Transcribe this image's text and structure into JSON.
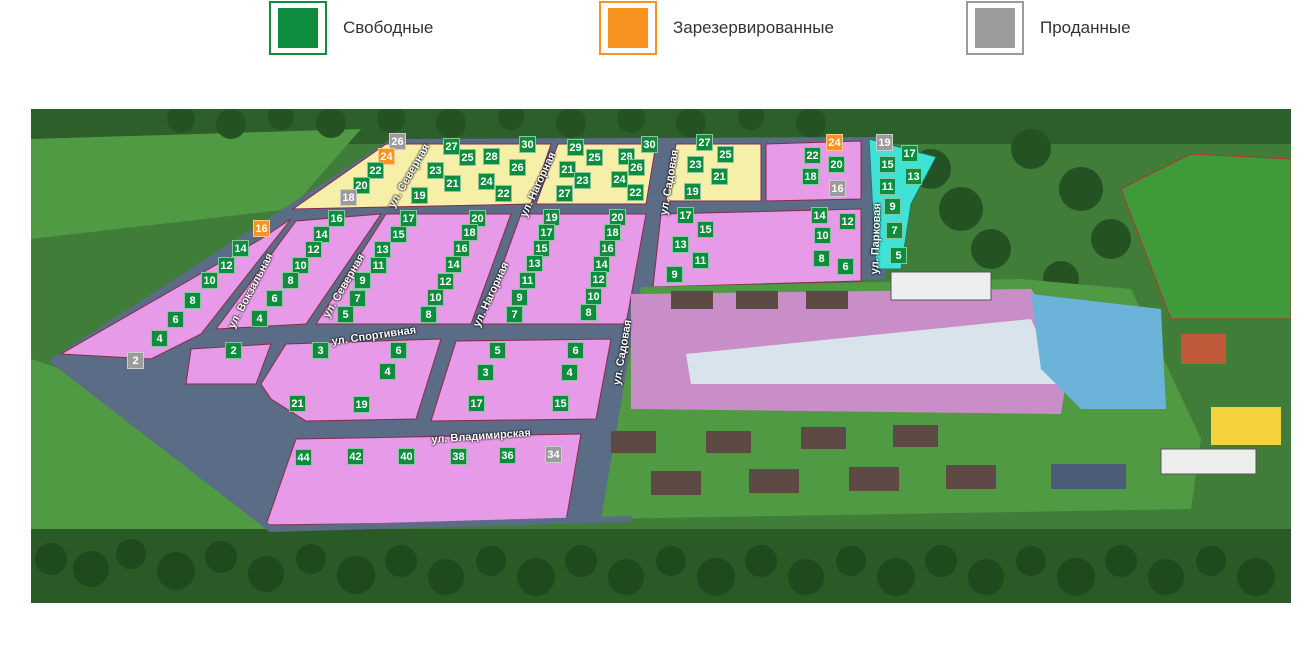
{
  "legend": [
    {
      "label": "Свободные",
      "color": "#0e8d3e",
      "border": "#0e8d3e"
    },
    {
      "label": "Зарезервированные",
      "color": "#f7931e",
      "border": "#f7931e"
    },
    {
      "label": "Проданные",
      "color": "#9b9b9b",
      "border": "#9b9b9b"
    }
  ],
  "colors": {
    "free": "#0e8d3e",
    "reserved": "#f7931e",
    "sold": "#9b9b9b",
    "plot_pink": "#e79ae8",
    "plot_yellow": "#f6efa8",
    "plot_cyan": "#3ee3d6",
    "road": "#5b6c86",
    "forest": "#2f6e2f"
  },
  "streets": [
    {
      "name": "ул. Вокзальная"
    },
    {
      "name": "ул. Северная"
    },
    {
      "name": "ул. Северная"
    },
    {
      "name": "ул. Нагорная"
    },
    {
      "name": "ул. Нагорная"
    },
    {
      "name": "ул. Садовая"
    },
    {
      "name": "ул. Садовая"
    },
    {
      "name": "ул. Парковая"
    },
    {
      "name": "ул. Спортивная"
    },
    {
      "name": "ул. Владимирская"
    }
  ],
  "plots": [
    {
      "n": "26",
      "status": "sold"
    },
    {
      "n": "24",
      "status": "reserved"
    },
    {
      "n": "22",
      "status": "free"
    },
    {
      "n": "20",
      "status": "free"
    },
    {
      "n": "18",
      "status": "sold"
    },
    {
      "n": "27",
      "status": "free"
    },
    {
      "n": "25",
      "status": "free"
    },
    {
      "n": "23",
      "status": "free"
    },
    {
      "n": "21",
      "status": "free"
    },
    {
      "n": "19",
      "status": "free"
    },
    {
      "n": "28",
      "status": "free"
    },
    {
      "n": "26",
      "status": "free"
    },
    {
      "n": "24",
      "status": "free"
    },
    {
      "n": "22",
      "status": "free"
    },
    {
      "n": "30",
      "status": "free"
    },
    {
      "n": "29",
      "status": "free"
    },
    {
      "n": "25",
      "status": "free"
    },
    {
      "n": "21",
      "status": "free"
    },
    {
      "n": "27",
      "status": "free"
    },
    {
      "n": "23",
      "status": "free"
    },
    {
      "n": "28",
      "status": "free"
    },
    {
      "n": "24",
      "status": "free"
    },
    {
      "n": "30",
      "status": "free"
    },
    {
      "n": "26",
      "status": "free"
    },
    {
      "n": "22",
      "status": "free"
    },
    {
      "n": "27",
      "status": "free"
    },
    {
      "n": "25",
      "status": "free"
    },
    {
      "n": "23",
      "status": "free"
    },
    {
      "n": "21",
      "status": "free"
    },
    {
      "n": "19",
      "status": "free"
    },
    {
      "n": "24",
      "status": "reserved"
    },
    {
      "n": "22",
      "status": "free"
    },
    {
      "n": "20",
      "status": "free"
    },
    {
      "n": "18",
      "status": "free"
    },
    {
      "n": "16",
      "status": "sold"
    },
    {
      "n": "19",
      "status": "sold"
    },
    {
      "n": "17",
      "status": "free"
    },
    {
      "n": "15",
      "status": "free"
    },
    {
      "n": "13",
      "status": "free"
    },
    {
      "n": "11",
      "status": "free"
    },
    {
      "n": "9",
      "status": "free"
    },
    {
      "n": "7",
      "status": "free"
    },
    {
      "n": "5",
      "status": "free"
    },
    {
      "n": "16",
      "status": "reserved"
    },
    {
      "n": "14",
      "status": "free"
    },
    {
      "n": "12",
      "status": "free"
    },
    {
      "n": "10",
      "status": "free"
    },
    {
      "n": "8",
      "status": "free"
    },
    {
      "n": "6",
      "status": "free"
    },
    {
      "n": "4",
      "status": "free"
    },
    {
      "n": "2",
      "status": "sold"
    },
    {
      "n": "16",
      "status": "free"
    },
    {
      "n": "14",
      "status": "free"
    },
    {
      "n": "12",
      "status": "free"
    },
    {
      "n": "10",
      "status": "free"
    },
    {
      "n": "8",
      "status": "free"
    },
    {
      "n": "6",
      "status": "free"
    },
    {
      "n": "4",
      "status": "free"
    },
    {
      "n": "17",
      "status": "free"
    },
    {
      "n": "15",
      "status": "free"
    },
    {
      "n": "13",
      "status": "free"
    },
    {
      "n": "11",
      "status": "free"
    },
    {
      "n": "9",
      "status": "free"
    },
    {
      "n": "7",
      "status": "free"
    },
    {
      "n": "5",
      "status": "free"
    },
    {
      "n": "20",
      "status": "free"
    },
    {
      "n": "18",
      "status": "free"
    },
    {
      "n": "16",
      "status": "free"
    },
    {
      "n": "14",
      "status": "free"
    },
    {
      "n": "12",
      "status": "free"
    },
    {
      "n": "10",
      "status": "free"
    },
    {
      "n": "8",
      "status": "free"
    },
    {
      "n": "19",
      "status": "free"
    },
    {
      "n": "17",
      "status": "free"
    },
    {
      "n": "15",
      "status": "free"
    },
    {
      "n": "13",
      "status": "free"
    },
    {
      "n": "11",
      "status": "free"
    },
    {
      "n": "9",
      "status": "free"
    },
    {
      "n": "7",
      "status": "free"
    },
    {
      "n": "20",
      "status": "free"
    },
    {
      "n": "18",
      "status": "free"
    },
    {
      "n": "16",
      "status": "free"
    },
    {
      "n": "14",
      "status": "free"
    },
    {
      "n": "12",
      "status": "free"
    },
    {
      "n": "10",
      "status": "free"
    },
    {
      "n": "8",
      "status": "free"
    },
    {
      "n": "17",
      "status": "free"
    },
    {
      "n": "15",
      "status": "free"
    },
    {
      "n": "13",
      "status": "free"
    },
    {
      "n": "11",
      "status": "free"
    },
    {
      "n": "9",
      "status": "free"
    },
    {
      "n": "14",
      "status": "free"
    },
    {
      "n": "12",
      "status": "free"
    },
    {
      "n": "10",
      "status": "free"
    },
    {
      "n": "8",
      "status": "free"
    },
    {
      "n": "6",
      "status": "free"
    },
    {
      "n": "2",
      "status": "free"
    },
    {
      "n": "3",
      "status": "free"
    },
    {
      "n": "6",
      "status": "free"
    },
    {
      "n": "4",
      "status": "free"
    },
    {
      "n": "21",
      "status": "free"
    },
    {
      "n": "19",
      "status": "free"
    },
    {
      "n": "5",
      "status": "free"
    },
    {
      "n": "6",
      "status": "free"
    },
    {
      "n": "3",
      "status": "free"
    },
    {
      "n": "4",
      "status": "free"
    },
    {
      "n": "17",
      "status": "free"
    },
    {
      "n": "15",
      "status": "free"
    },
    {
      "n": "44",
      "status": "free"
    },
    {
      "n": "42",
      "status": "free"
    },
    {
      "n": "40",
      "status": "free"
    },
    {
      "n": "38",
      "status": "free"
    },
    {
      "n": "36",
      "status": "free"
    },
    {
      "n": "34",
      "status": "sold"
    }
  ]
}
